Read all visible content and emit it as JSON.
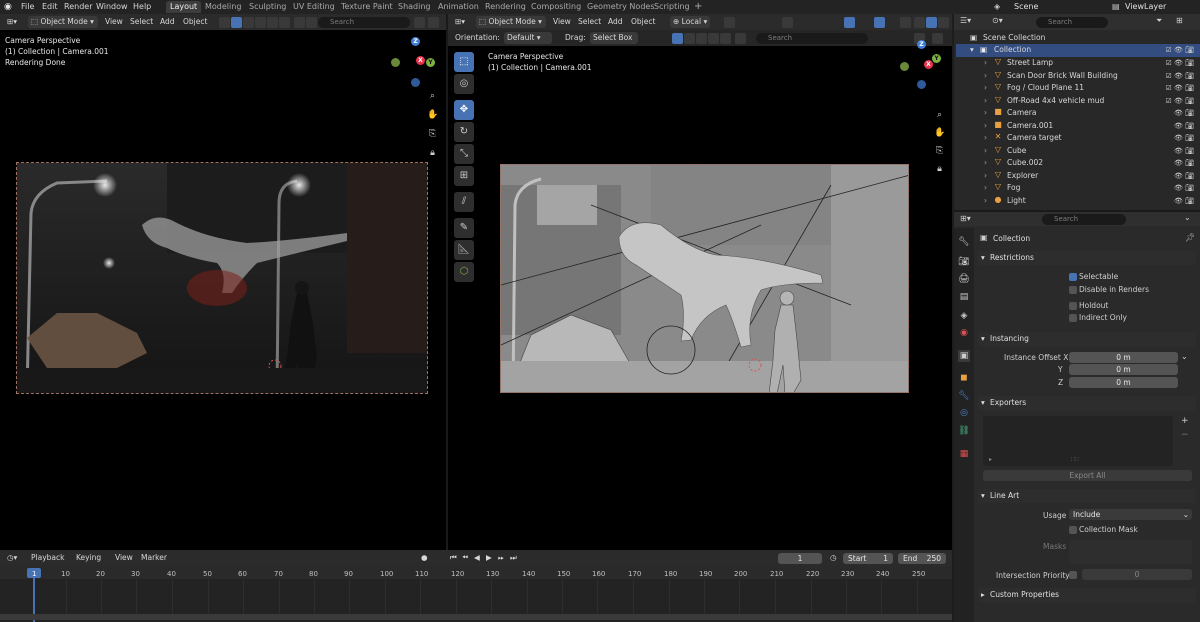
{
  "top_menu": [
    "File",
    "Edit",
    "Render",
    "Window",
    "Help"
  ],
  "workspaces": [
    "Layout",
    "Modeling",
    "Sculpting",
    "UV Editing",
    "Texture Paint",
    "Shading",
    "Animation",
    "Rendering",
    "Compositing",
    "Geometry Nodes",
    "Scripting"
  ],
  "active_workspace": "Layout",
  "scene": "Scene",
  "view_layer": "ViewLayer",
  "left_viewport": {
    "mode": "Object Mode",
    "menus": [
      "View",
      "Select",
      "Add",
      "Object"
    ],
    "search_placeholder": "Search",
    "overlay_title": "Camera Perspective",
    "overlay_collection": "(1) Collection | Camera.001",
    "overlay_status": "Rendering Done"
  },
  "right_viewport": {
    "mode": "Object Mode",
    "menus": [
      "View",
      "Select",
      "Add",
      "Object"
    ],
    "transform_space": "Local",
    "orientation_label": "Orientation:",
    "orientation_value": "Default",
    "drag_label": "Drag:",
    "drag_value": "Select Box",
    "search_placeholder": "Search",
    "overlay_title": "Camera Perspective",
    "overlay_collection": "(1) Collection | Camera.001"
  },
  "outliner": {
    "search_placeholder": "Search",
    "root": "Scene Collection",
    "collection": "Collection",
    "items": [
      {
        "label": "Street Lamp",
        "icon": "▽",
        "color": "#e8a040"
      },
      {
        "label": "Scan Door Brick Wall Building",
        "icon": "▽",
        "color": "#e8a040"
      },
      {
        "label": "Fog / Cloud Plane 11",
        "icon": "▽",
        "color": "#e8a040"
      },
      {
        "label": "Off-Road 4x4 vehicle mud",
        "icon": "▽",
        "color": "#e8a040"
      },
      {
        "label": "Camera",
        "icon": "■",
        "color": "#e8a040"
      },
      {
        "label": "Camera.001",
        "icon": "■",
        "color": "#e8a040"
      },
      {
        "label": "Camera target",
        "icon": "✕",
        "color": "#e8a040"
      },
      {
        "label": "Cube",
        "icon": "▽",
        "color": "#e8a040"
      },
      {
        "label": "Cube.002",
        "icon": "▽",
        "color": "#e8a040"
      },
      {
        "label": "Explorer",
        "icon": "▽",
        "color": "#e8a040"
      },
      {
        "label": "Fog",
        "icon": "▽",
        "color": "#e8a040"
      },
      {
        "label": "Light",
        "icon": "●",
        "color": "#e8a040"
      }
    ]
  },
  "properties": {
    "search_placeholder": "Search",
    "context": "Collection",
    "restrictions": {
      "title": "Restrictions",
      "selectable": "Selectable",
      "disable_renders": "Disable in Renders",
      "holdout": "Holdout",
      "indirect_only": "Indirect Only"
    },
    "instancing": {
      "title": "Instancing",
      "offset_x_label": "Instance Offset X",
      "y_label": "Y",
      "z_label": "Z",
      "x_value": "0 m",
      "y_value": "0 m",
      "z_value": "0 m"
    },
    "exporters": {
      "title": "Exporters",
      "export_all": "Export All"
    },
    "line_art": {
      "title": "Line Art",
      "usage_label": "Usage",
      "usage_value": "Include",
      "collection_mask": "Collection Mask",
      "masks_label": "Masks",
      "intersection_priority": "Intersection Priority",
      "intersection_value": "0"
    },
    "custom_properties": "Custom Properties"
  },
  "timeline": {
    "menus": [
      "Playback",
      "Keying",
      "View",
      "Marker"
    ],
    "current_frame": "1",
    "start_label": "Start",
    "start": "1",
    "end_label": "End",
    "end": "250",
    "ticks": [
      "1",
      "10",
      "20",
      "30",
      "40",
      "50",
      "60",
      "70",
      "80",
      "90",
      "100",
      "110",
      "120",
      "130",
      "140",
      "150",
      "160",
      "170",
      "180",
      "190",
      "200",
      "210",
      "220",
      "230",
      "240",
      "250"
    ]
  },
  "colors": {
    "accent": "#4772b3",
    "selection": "#334d80",
    "axis_x": "#e8334a",
    "axis_y": "#7cb342",
    "axis_z": "#3f7fd9"
  }
}
